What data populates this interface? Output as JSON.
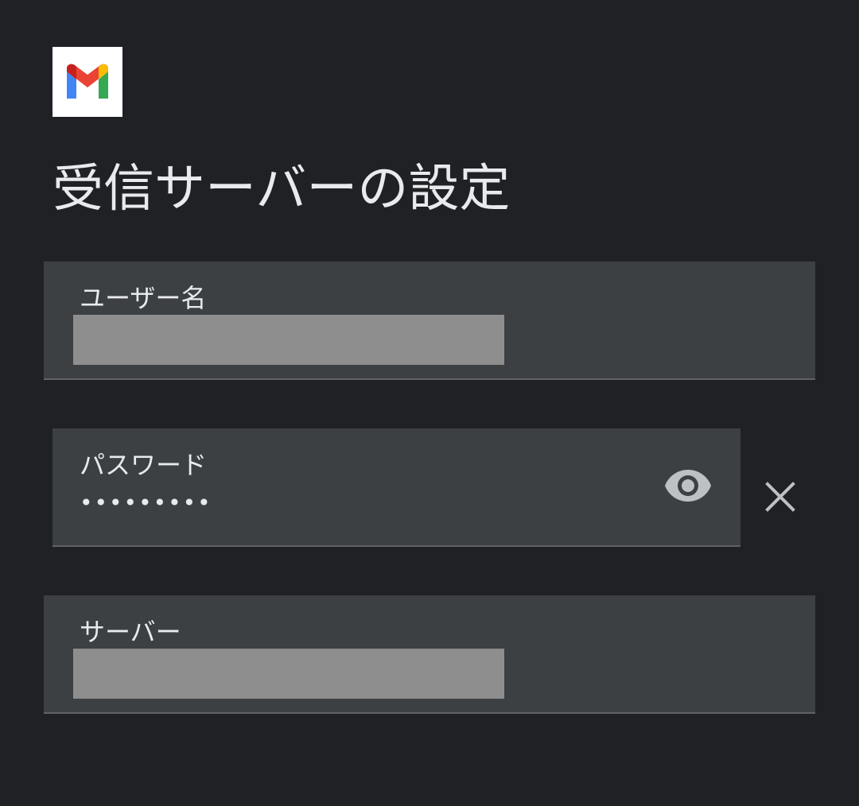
{
  "header": {
    "logo_icon": "gmail-logo-icon",
    "title": "受信サーバーの設定"
  },
  "form": {
    "username": {
      "label": "ユーザー名",
      "value_state": "redacted"
    },
    "password": {
      "label": "パスワード",
      "value": "•••••••••",
      "visibility_icon": "eye-icon",
      "clear_icon": "close-icon"
    },
    "server": {
      "label": "サーバー",
      "value_state": "redacted"
    }
  },
  "colors": {
    "background": "#202124",
    "field_background": "#3c4043",
    "field_underline": "#5f6368",
    "text": "#e8eaed",
    "icon": "#bdc1c6",
    "redaction": "#8e8e8e",
    "gmail_red": "#ea4335",
    "gmail_blue": "#4285f4",
    "gmail_green": "#34a853",
    "gmail_yellow": "#fbbc04"
  }
}
